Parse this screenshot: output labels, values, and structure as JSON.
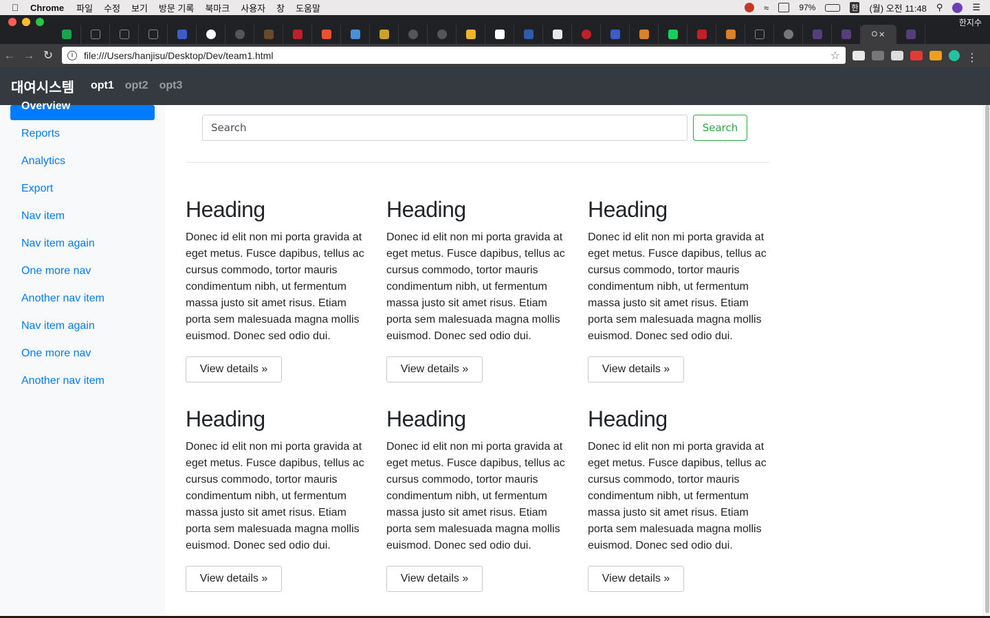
{
  "menubar": {
    "app_name": "Chrome",
    "menus": [
      "파일",
      "수정",
      "보기",
      "방문 기록",
      "북마크",
      "사용자",
      "창",
      "도움말"
    ],
    "battery": "97%",
    "input_method": "한",
    "datetime": "(월) 오전 11:48"
  },
  "tabstrip": {
    "tab_count_visible": 28,
    "user_name": "한지수",
    "active_tab_glyph": "O"
  },
  "address_bar": {
    "url": "file:///Users/hanjisu/Desktop/Dev/team1.html"
  },
  "navbar": {
    "brand": "대여시스템",
    "links": [
      {
        "label": "opt1",
        "active": true
      },
      {
        "label": "opt2",
        "active": false
      },
      {
        "label": "opt3",
        "active": false
      }
    ]
  },
  "sidebar": {
    "items": [
      {
        "label": "Overview",
        "active": true
      },
      {
        "label": "Reports"
      },
      {
        "label": "Analytics"
      },
      {
        "label": "Export"
      },
      {
        "label": "Nav item"
      },
      {
        "label": "Nav item again"
      },
      {
        "label": "One more nav"
      },
      {
        "label": "Another nav item"
      },
      {
        "label": "Nav item again"
      },
      {
        "label": "One more nav"
      },
      {
        "label": "Another nav item"
      }
    ]
  },
  "search": {
    "placeholder": "Search",
    "button_label": "Search"
  },
  "cards": [
    {
      "heading": "Heading",
      "body": "Donec id elit non mi porta gravida at eget metus. Fusce dapibus, tellus ac cursus commodo, tortor mauris condimentum nibh, ut fermentum massa justo sit amet risus. Etiam porta sem malesuada magna mollis euismod. Donec sed odio dui.",
      "button": "View details »"
    },
    {
      "heading": "Heading",
      "body": "Donec id elit non mi porta gravida at eget metus. Fusce dapibus, tellus ac cursus commodo, tortor mauris condimentum nibh, ut fermentum massa justo sit amet risus. Etiam porta sem malesuada magna mollis euismod. Donec sed odio dui.",
      "button": "View details »"
    },
    {
      "heading": "Heading",
      "body": "Donec id elit non mi porta gravida at eget metus. Fusce dapibus, tellus ac cursus commodo, tortor mauris condimentum nibh, ut fermentum massa justo sit amet risus. Etiam porta sem malesuada magna mollis euismod. Donec sed odio dui.",
      "button": "View details »"
    },
    {
      "heading": "Heading",
      "body": "Donec id elit non mi porta gravida at eget metus. Fusce dapibus, tellus ac cursus commodo, tortor mauris condimentum nibh, ut fermentum massa justo sit amet risus. Etiam porta sem malesuada magna mollis euismod. Donec sed odio dui.",
      "button": "View details »"
    },
    {
      "heading": "Heading",
      "body": "Donec id elit non mi porta gravida at eget metus. Fusce dapibus, tellus ac cursus commodo, tortor mauris condimentum nibh, ut fermentum massa justo sit amet risus. Etiam porta sem malesuada magna mollis euismod. Donec sed odio dui.",
      "button": "View details »"
    },
    {
      "heading": "Heading",
      "body": "Donec id elit non mi porta gravida at eget metus. Fusce dapibus, tellus ac cursus commodo, tortor mauris condimentum nibh, ut fermentum massa justo sit amet risus. Etiam porta sem malesuada magna mollis euismod. Donec sed odio dui.",
      "button": "View details »"
    }
  ],
  "colors": {
    "primary": "#007bff",
    "success": "#28a745",
    "navbar_bg": "#343a40",
    "sidebar_bg": "#f8f9fa"
  }
}
